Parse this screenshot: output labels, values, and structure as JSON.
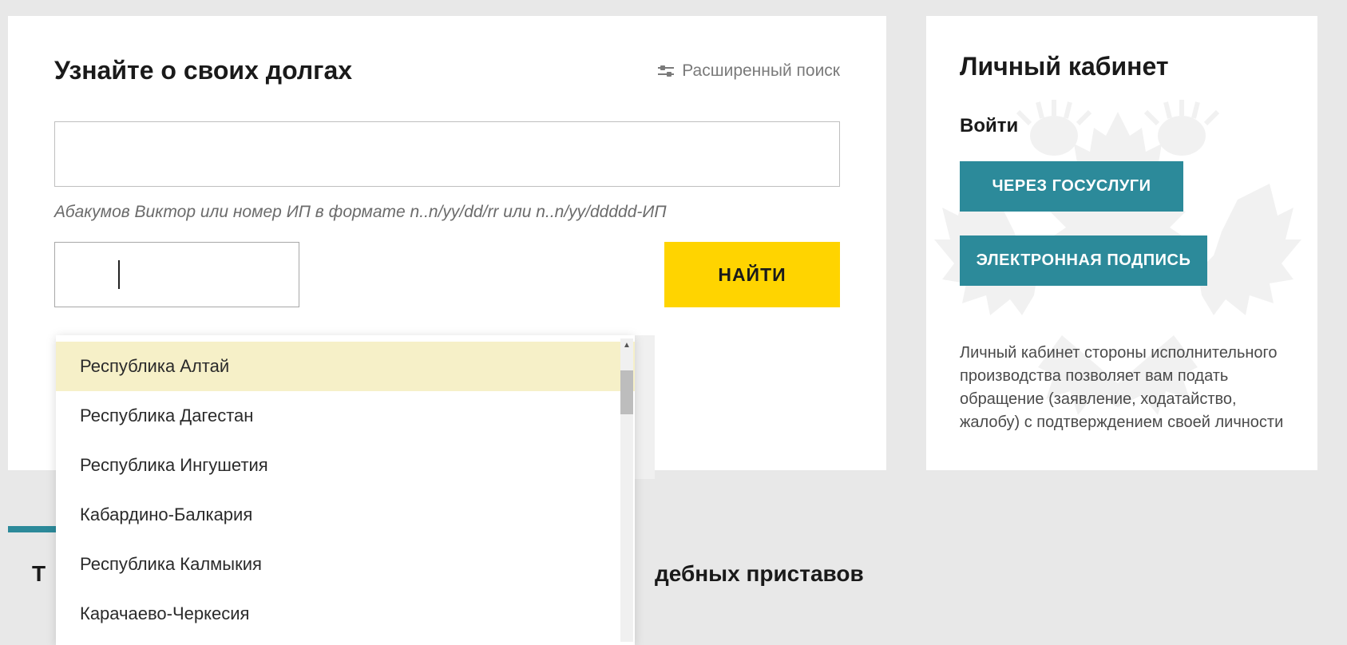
{
  "main": {
    "title": "Узнайте о своих долгах",
    "advanced_search": "Расширенный поиск",
    "hint": "Абакумов Виктор или номер ИП в формате n..n/yy/dd/rr или n..n/yy/ddddd-ИП",
    "find_button": "НАЙТИ"
  },
  "dropdown": {
    "options": [
      "Республика Алтай",
      "Республика Дагестан",
      "Республика Ингушетия",
      "Кабардино-Балкария",
      "Республика Калмыкия",
      "Карачаево-Черкесия"
    ],
    "highlighted_index": 0
  },
  "sidebar": {
    "title": "Личный кабинет",
    "login_label": "Войти",
    "gosuslugi_btn": "ЧЕРЕЗ ГОСУСЛУГИ",
    "signature_btn": "ЭЛЕКТРОННАЯ ПОДПИСЬ",
    "description": "Личный кабинет стороны исполнительного производства позволяет вам подать обращение (заявление, ходатайство, жалобу) с подтверждением своей личности"
  },
  "tabs": {
    "left_fragment": "Т",
    "right_fragment": "дебных приставов"
  }
}
